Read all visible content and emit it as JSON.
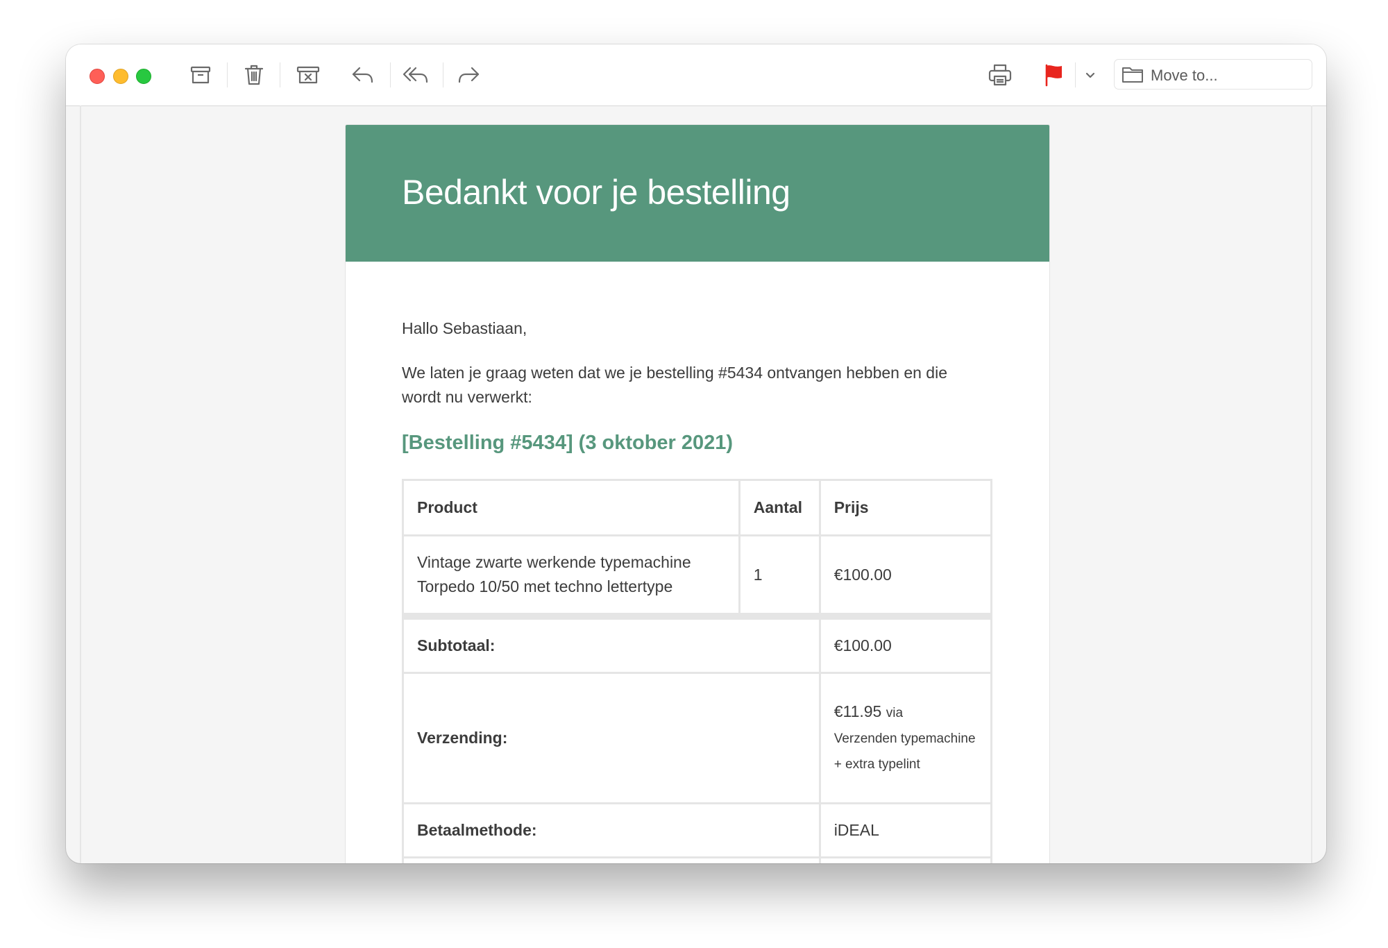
{
  "toolbar": {
    "move_to_label": "Move to...",
    "icons": [
      "archive-icon",
      "trash-icon",
      "junk-icon",
      "reply-icon",
      "reply-all-icon",
      "forward-icon",
      "print-icon",
      "flag-icon",
      "chevron-down-icon",
      "folder-icon"
    ],
    "flag_color": "#e8251e"
  },
  "email": {
    "header_color": "#57977d",
    "title": "Bedankt voor je bestelling",
    "greeting": "Hallo Sebastiaan,",
    "intro": "We laten je graag weten dat we je bestelling #5434 ontvangen hebben en die wordt nu verwerkt:",
    "order_heading": "[Bestelling #5434] (3 oktober 2021)",
    "table": {
      "headers": {
        "product": "Product",
        "quantity": "Aantal",
        "price": "Prijs"
      },
      "items": [
        {
          "product": "Vintage zwarte werkende typemachine Torpedo 10/50 met techno lettertype",
          "quantity": "1",
          "price": "€100.00"
        }
      ],
      "subtotal_label": "Subtotaal:",
      "subtotal_value": "€100.00",
      "shipping_label": "Verzending:",
      "shipping_amount": "€11.95",
      "shipping_via": "via",
      "shipping_method": "Verzenden typemachine + extra typelint",
      "payment_label": "Betaalmethode:",
      "payment_value": "iDEAL"
    }
  }
}
